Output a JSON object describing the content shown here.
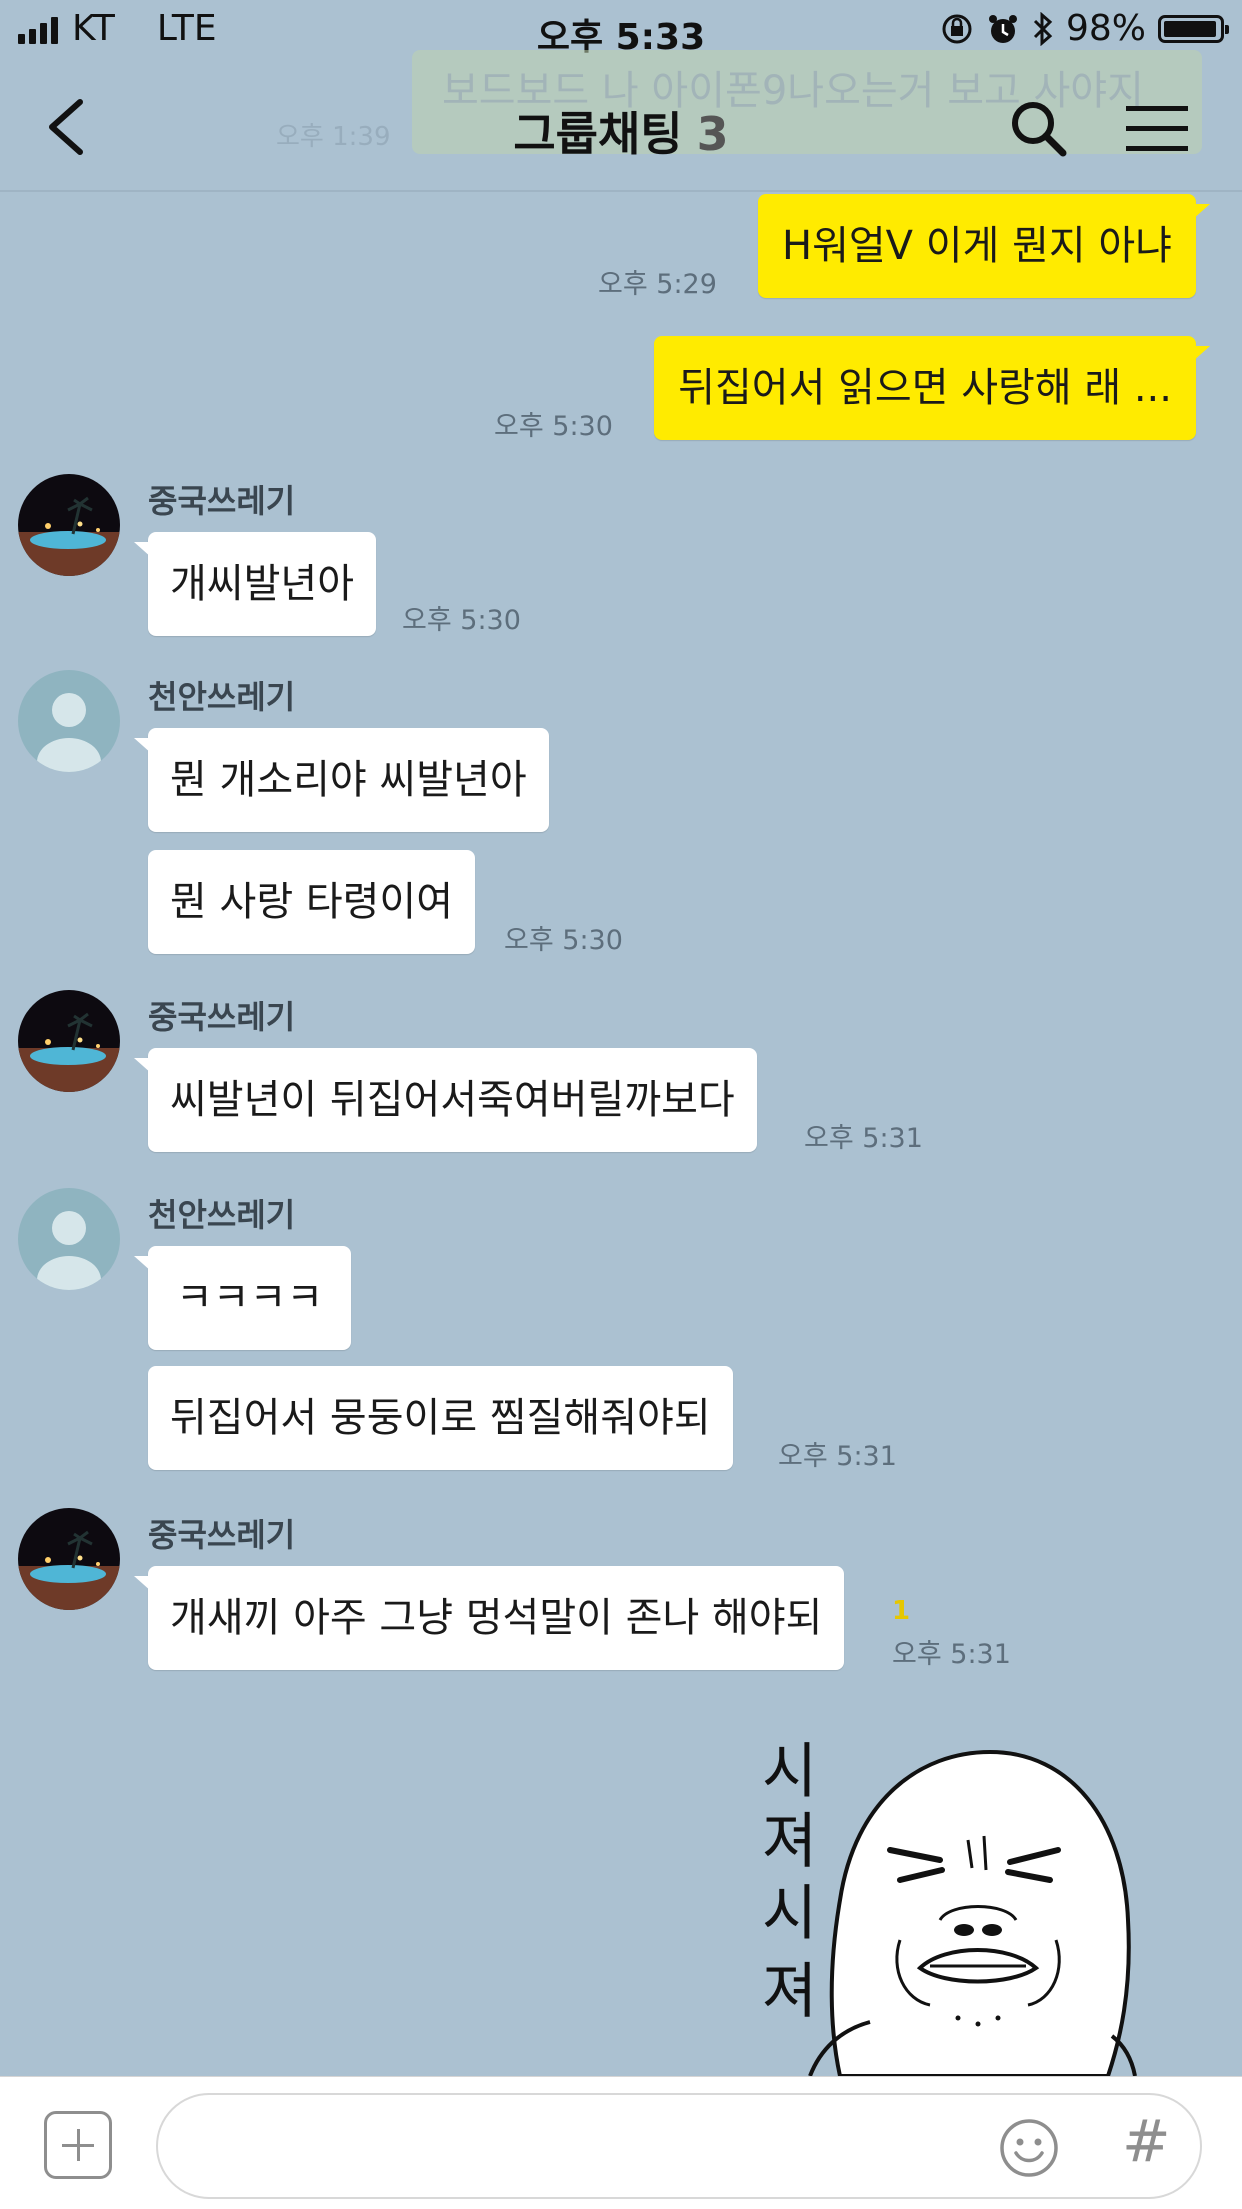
{
  "status_bar": {
    "carrier": "KT",
    "network": "LTE",
    "time": "오후 5:33",
    "battery": "98%"
  },
  "header": {
    "title": "그룹채팅",
    "member_count": "3",
    "ghost_text": "보드보드 나 아이폰9나오는거 보고 사야지",
    "ghost_time": "오후 1:39"
  },
  "messages": [
    {
      "sender": "me",
      "text": "H워얼V 이게 뭔지 아냐",
      "time": "오후 5:29"
    },
    {
      "sender": "me",
      "text": "뒤집어서 읽으면 사랑해 래 ...",
      "time": "오후 5:30"
    },
    {
      "sender": "중국쓰레기",
      "text": "개씨발년아",
      "time": "오후 5:30"
    },
    {
      "sender": "천안쓰레기",
      "text": "뭔 개소리야 씨발년아"
    },
    {
      "sender": "천안쓰레기",
      "text": "뭔 사랑 타령이여",
      "time": "오후 5:30"
    },
    {
      "sender": "중국쓰레기",
      "text": "씨발년이 뒤집어서죽여버릴까보다",
      "time": "오후 5:31"
    },
    {
      "sender": "천안쓰레기",
      "text": "ㅋㅋㅋㅋ"
    },
    {
      "sender": "천안쓰레기",
      "text": "뒤집어서 뭉둥이로 찜질해줘야되",
      "time": "오후 5:31"
    },
    {
      "sender": "중국쓰레기",
      "text": "개새끼 아주 그냥 멍석말이 존나 해야되",
      "time": "오후 5:31",
      "unread": "1"
    }
  ],
  "senders": {
    "a": "중국쓰레기",
    "b": "천안쓰레기"
  },
  "sticker": {
    "text": [
      "시",
      "져",
      "시",
      "져"
    ]
  },
  "input": {
    "placeholder": ""
  },
  "icons": {
    "back": "chevron-left-icon",
    "search": "search-icon",
    "menu": "hamburger-menu-icon",
    "plus": "plus-icon",
    "emoji": "emoji-icon",
    "hash": "hash-icon"
  },
  "colors": {
    "background": "#abc1d1",
    "my_bubble": "#ffeb00",
    "other_bubble": "#ffffff"
  }
}
